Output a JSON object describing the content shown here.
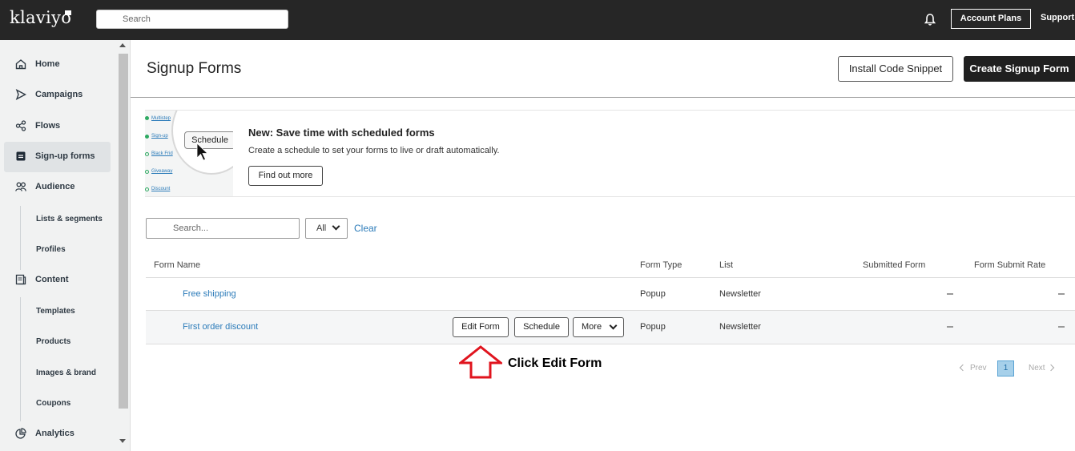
{
  "topbar": {
    "logo": "klaviyo",
    "search_placeholder": "Search",
    "account_plans": "Account Plans",
    "support": "Support"
  },
  "sidebar": {
    "items": [
      {
        "label": "Home",
        "icon": "home-icon"
      },
      {
        "label": "Campaigns",
        "icon": "send-icon"
      },
      {
        "label": "Flows",
        "icon": "flows-icon"
      },
      {
        "label": "Sign-up forms",
        "icon": "form-icon",
        "active": true
      },
      {
        "label": "Audience",
        "icon": "audience-icon"
      },
      {
        "label": "Content",
        "icon": "content-icon"
      },
      {
        "label": "Analytics",
        "icon": "analytics-icon"
      }
    ],
    "audience_sub": [
      "Lists & segments",
      "Profiles"
    ],
    "content_sub": [
      "Templates",
      "Products",
      "Images & brand",
      "Coupons"
    ]
  },
  "header": {
    "title": "Signup Forms",
    "install_snippet": "Install Code Snippet",
    "create_form": "Create Signup Form"
  },
  "banner": {
    "title": "New: Save time with scheduled forms",
    "description": "Create a schedule to set your forms to live or draft automatically.",
    "button": "Find out more",
    "image_rows": [
      "Multistep",
      "Sign-up",
      "Black Frid",
      "Giveaway",
      "Discount"
    ],
    "image_button": "Schedule"
  },
  "filters": {
    "search_placeholder": "Search...",
    "select_value": "All",
    "clear": "Clear"
  },
  "table": {
    "columns": [
      "Form Name",
      "Form Type",
      "List",
      "Submitted Form",
      "Form Submit Rate"
    ],
    "rows": [
      {
        "name": "Free shipping",
        "type": "Popup",
        "list": "Newsletter"
      },
      {
        "name": "First order discount",
        "type": "Popup",
        "list": "Newsletter"
      }
    ],
    "row_actions": {
      "edit": "Edit Form",
      "schedule": "Schedule",
      "more": "More"
    }
  },
  "annotation": {
    "text": "Click Edit Form",
    "color": "#e0141e"
  },
  "pagination": {
    "prev": "Prev",
    "current": "1",
    "next": "Next"
  }
}
